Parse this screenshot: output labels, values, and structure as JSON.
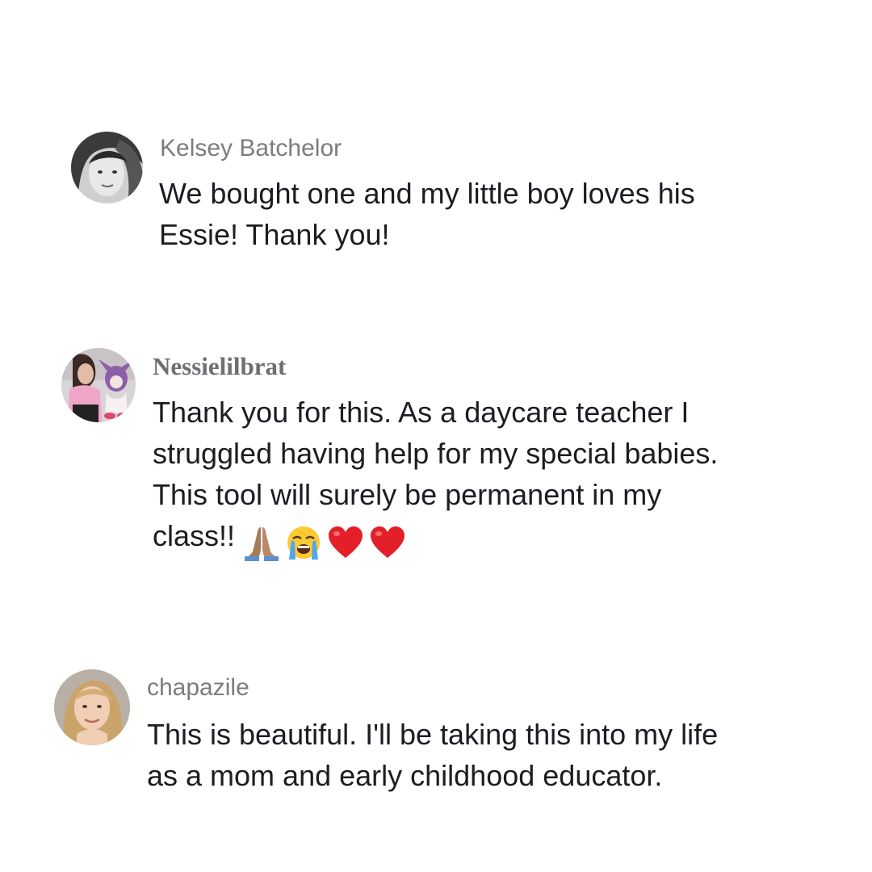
{
  "comments": [
    {
      "username": "Kelsey Batchelor",
      "text": "We bought one and my little boy loves his\nEssie! Thank you!"
    },
    {
      "username": "Nessielilbrat",
      "text": "Thank you for this. As a daycare teacher I\nstruggled having help for my special babies.\nThis tool will surely be permanent in my\nclass!!",
      "emojis": [
        "folded-hands",
        "loudly-crying-face",
        "red-heart",
        "red-heart"
      ]
    },
    {
      "username": "chapazile",
      "text": "This is beautiful. I'll be taking this into my life\nas a mom and early childhood educator."
    }
  ],
  "colors": {
    "background": "#ffffff",
    "username": "#7c7c80",
    "text": "#1c1c22",
    "heart": "#e3202a"
  }
}
